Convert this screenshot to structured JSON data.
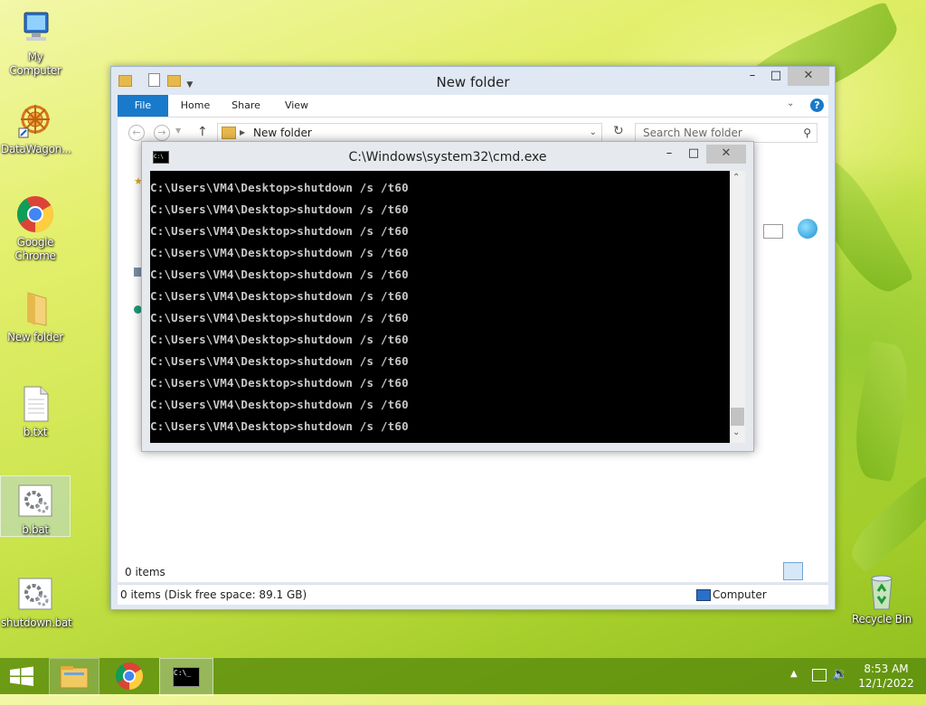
{
  "desktop": {
    "icons": [
      {
        "label": "My Computer"
      },
      {
        "label": "DataWagon..."
      },
      {
        "label": "Google Chrome"
      },
      {
        "label": "New folder"
      },
      {
        "label": "b.txt"
      },
      {
        "label": "b.bat"
      },
      {
        "label": "shutdown.bat"
      },
      {
        "label": "Recycle Bin"
      }
    ]
  },
  "explorer": {
    "title": "New folder",
    "ribbon_tabs": [
      "File",
      "Home",
      "Share",
      "View"
    ],
    "address": "New folder",
    "search_placeholder": "Search New folder",
    "items_count": "0 items",
    "status_left": "0 items (Disk free space: 89.1 GB)",
    "status_right": "Computer"
  },
  "cmd": {
    "title": "C:\\Windows\\system32\\cmd.exe",
    "lines": [
      "C:\\Users\\VM4\\Desktop>shutdown /s /t60",
      "C:\\Users\\VM4\\Desktop>shutdown /s /t60",
      "C:\\Users\\VM4\\Desktop>shutdown /s /t60",
      "C:\\Users\\VM4\\Desktop>shutdown /s /t60",
      "C:\\Users\\VM4\\Desktop>shutdown /s /t60",
      "C:\\Users\\VM4\\Desktop>shutdown /s /t60",
      "C:\\Users\\VM4\\Desktop>shutdown /s /t60",
      "C:\\Users\\VM4\\Desktop>shutdown /s /t60",
      "C:\\Users\\VM4\\Desktop>shutdown /s /t60",
      "C:\\Users\\VM4\\Desktop>shutdown /s /t60",
      "C:\\Users\\VM4\\Desktop>shutdown /s /t60",
      "C:\\Users\\VM4\\Desktop>shutdown /s /t60"
    ],
    "icon_text": "C:\\"
  },
  "taskbar": {
    "cmd_icon_text": "C:\\_",
    "time": "8:53 AM",
    "date": "12/1/2022"
  },
  "colors": {
    "accent": "#1979ca",
    "taskbar": "#5c8c0e",
    "console_bg": "#000000",
    "console_fg": "#c8c8c8"
  }
}
